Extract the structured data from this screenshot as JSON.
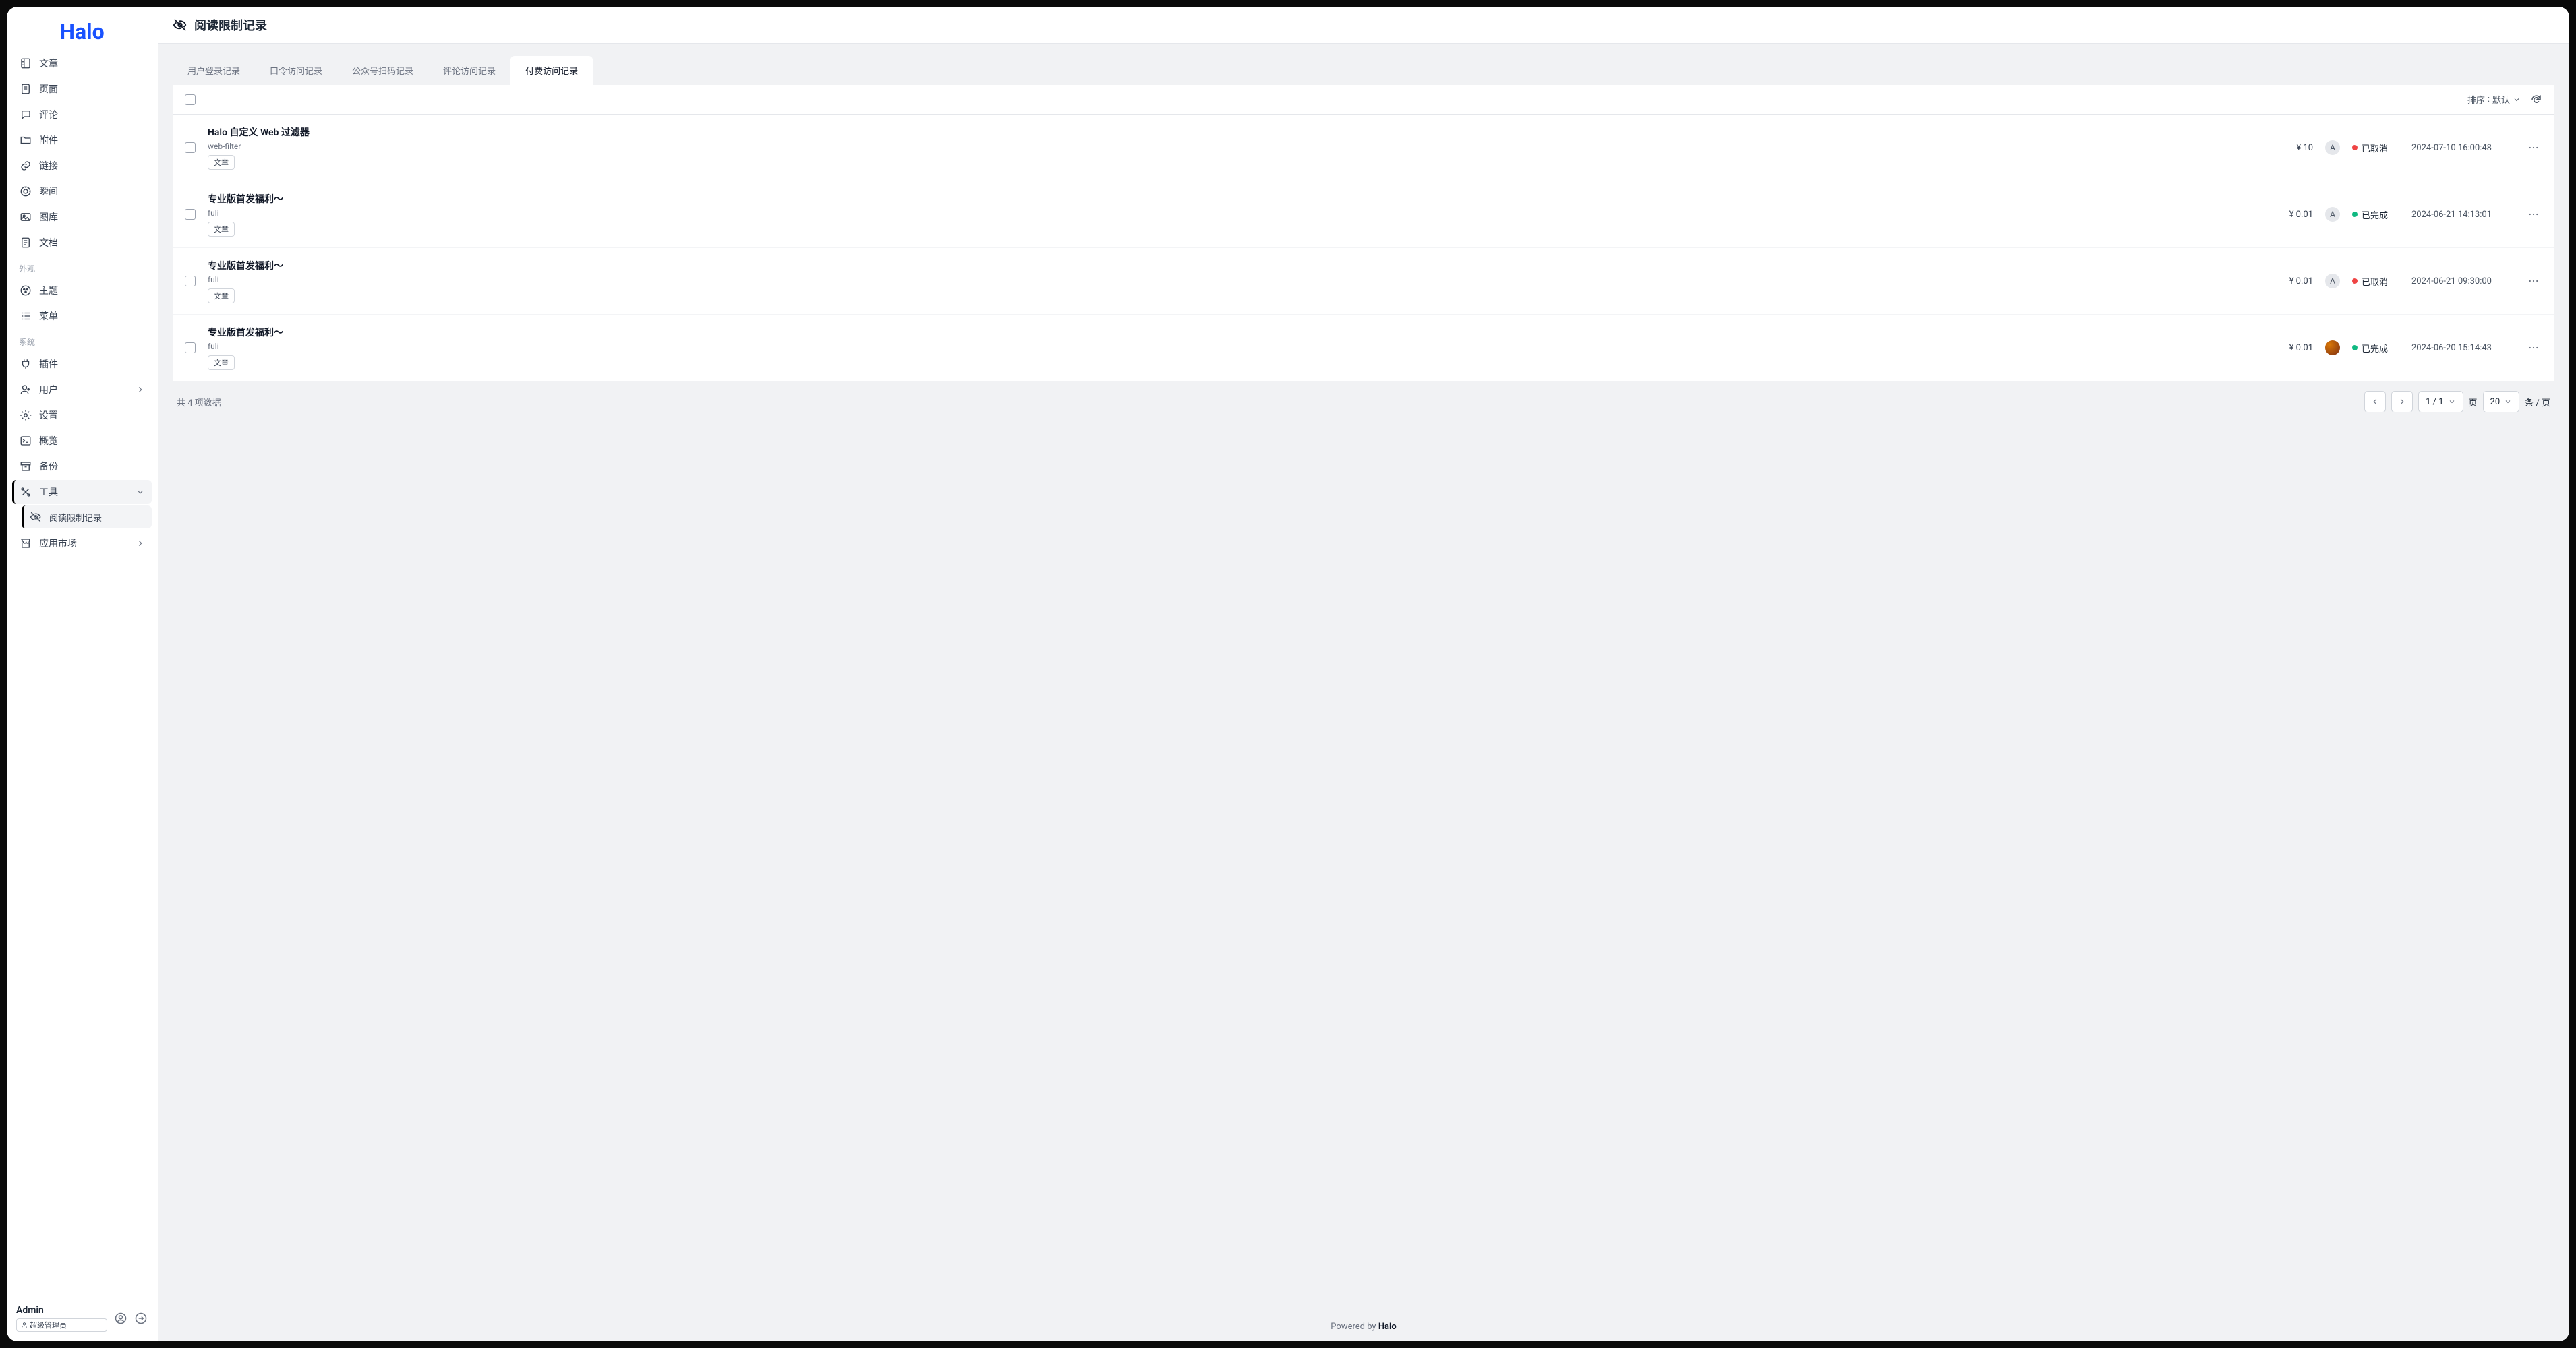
{
  "brand": "Halo",
  "page_title": "阅读限制记录",
  "sidebar": {
    "groups": [
      {
        "label": null,
        "items": [
          {
            "label": "文章",
            "icon": "document-icon"
          },
          {
            "label": "页面",
            "icon": "page-icon"
          },
          {
            "label": "评论",
            "icon": "comment-icon"
          },
          {
            "label": "附件",
            "icon": "folder-icon"
          },
          {
            "label": "链接",
            "icon": "link-icon"
          },
          {
            "label": "瞬间",
            "icon": "calendar-icon"
          },
          {
            "label": "图库",
            "icon": "image-icon"
          },
          {
            "label": "文档",
            "icon": "doc-icon"
          }
        ]
      },
      {
        "label": "外观",
        "items": [
          {
            "label": "主题",
            "icon": "palette-icon"
          },
          {
            "label": "菜单",
            "icon": "list-icon"
          }
        ]
      },
      {
        "label": "系统",
        "items": [
          {
            "label": "插件",
            "icon": "plug-icon"
          },
          {
            "label": "用户",
            "icon": "user-icon",
            "has_chevron": true
          },
          {
            "label": "设置",
            "icon": "gear-icon"
          },
          {
            "label": "概览",
            "icon": "terminal-icon"
          },
          {
            "label": "备份",
            "icon": "archive-icon"
          },
          {
            "label": "工具",
            "icon": "tools-icon",
            "active": true,
            "has_chevron": true,
            "expanded": true,
            "children": [
              {
                "label": "阅读限制记录",
                "icon": "eye-off-icon",
                "active": true
              }
            ]
          },
          {
            "label": "应用市场",
            "icon": "store-icon",
            "has_chevron": true
          }
        ]
      }
    ],
    "footer": {
      "username": "Admin",
      "role": "超级管理员"
    }
  },
  "tabs": [
    {
      "label": "用户登录记录"
    },
    {
      "label": "口令访问记录"
    },
    {
      "label": "公众号扫码记录"
    },
    {
      "label": "评论访问记录"
    },
    {
      "label": "付费访问记录",
      "active": true
    }
  ],
  "toolbar": {
    "sort_label": "排序",
    "sort_value": "默认"
  },
  "rows": [
    {
      "title": "Halo 自定义 Web 过滤器",
      "slug": "web-filter",
      "tag": "文章",
      "price": "¥ 10",
      "avatar": "A",
      "avatar_img": false,
      "status": "已取消",
      "status_color": "red",
      "time": "2024-07-10 16:00:48"
    },
    {
      "title": "专业版首发福利～",
      "slug": "fuli",
      "tag": "文章",
      "price": "¥ 0.01",
      "avatar": "A",
      "avatar_img": false,
      "status": "已完成",
      "status_color": "green",
      "time": "2024-06-21 14:13:01"
    },
    {
      "title": "专业版首发福利～",
      "slug": "fuli",
      "tag": "文章",
      "price": "¥ 0.01",
      "avatar": "A",
      "avatar_img": false,
      "status": "已取消",
      "status_color": "red",
      "time": "2024-06-21 09:30:00"
    },
    {
      "title": "专业版首发福利～",
      "slug": "fuli",
      "tag": "文章",
      "price": "¥ 0.01",
      "avatar": "",
      "avatar_img": true,
      "status": "已完成",
      "status_color": "green",
      "time": "2024-06-20 15:14:43"
    }
  ],
  "pagination": {
    "total_text": "共 4 项数据",
    "page": "1 / 1",
    "page_label": "页",
    "size": "20",
    "size_label": "条 / 页"
  },
  "footer": {
    "prefix": "Powered by ",
    "brand": "Halo"
  }
}
